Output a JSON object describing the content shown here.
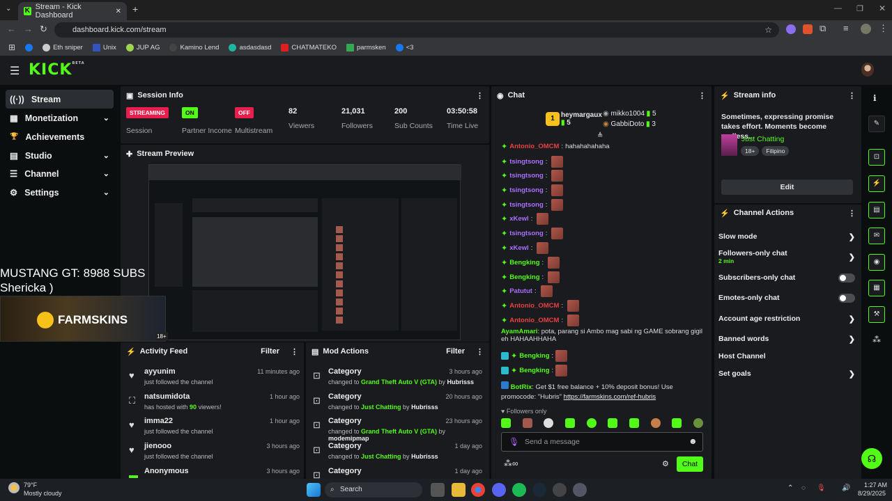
{
  "browser": {
    "tab_title": "Stream - Kick Dashboard",
    "url": "dashboard.kick.com/stream",
    "bookmarks": [
      "Eth sniper",
      "Unix",
      "JUP AG",
      "Kamino Lend",
      "asdasdasd",
      "CHATMATEKO",
      "parmsken",
      "<3"
    ]
  },
  "brand": {
    "logo": "KICK",
    "beta": "BETA"
  },
  "sidebar": {
    "items": [
      {
        "label": "Stream",
        "icon": "((·))"
      },
      {
        "label": "Monetization",
        "icon": "▦"
      },
      {
        "label": "Achievements",
        "icon": "🏆"
      },
      {
        "label": "Studio",
        "icon": "▤"
      },
      {
        "label": "Channel",
        "icon": "☰"
      },
      {
        "label": "Settings",
        "icon": "⚙"
      }
    ]
  },
  "session": {
    "title": "Session Info",
    "stats": [
      {
        "value": "STREAMING",
        "label": "Session"
      },
      {
        "value": "ON",
        "label": "Partner Income"
      },
      {
        "value": "OFF",
        "label": "Multistream"
      },
      {
        "value": "82",
        "label": "Viewers"
      },
      {
        "value": "21,031",
        "label": "Followers"
      },
      {
        "value": "200",
        "label": "Sub Counts"
      },
      {
        "value": "03:50:58",
        "label": "Time Live"
      }
    ]
  },
  "preview": {
    "title": "Stream Preview",
    "overlay_line1": "MUSTANG GT: 8988 SUBS",
    "overlay_line2": "Shericka )",
    "sponsor": "FARMSKINS",
    "rating": "18+"
  },
  "activity": {
    "title": "Activity Feed",
    "filter": "Filter",
    "rows": [
      {
        "name": "ayyunim",
        "text": "just followed the channel",
        "time": "11 minutes ago"
      },
      {
        "name": "natsumidota",
        "text_pre": "has hosted with ",
        "text_hl": "90",
        "text_post": " viewers!",
        "time": "1 hour ago"
      },
      {
        "name": "imma22",
        "text": "just followed the channel",
        "time": "1 hour ago"
      },
      {
        "name": "jienooo",
        "text": "just followed the channel",
        "time": "3 hours ago"
      },
      {
        "name": "Anonymous",
        "text": "",
        "time": "3 hours ago"
      }
    ]
  },
  "mod": {
    "title": "Mod Actions",
    "filter": "Filter",
    "rows": [
      {
        "name": "Category",
        "pre": "changed to ",
        "hl": "Grand Theft Auto V (GTA)",
        "by": "Hubrisss",
        "time": "3 hours ago"
      },
      {
        "name": "Category",
        "pre": "changed to ",
        "hl": "Just Chatting",
        "by": "Hubrisss",
        "time": "20 hours ago"
      },
      {
        "name": "Category",
        "pre": "changed to ",
        "hl": "Grand Theft Auto V (GTA)",
        "by": "modemipmap",
        "time": "23 hours ago"
      },
      {
        "name": "Category",
        "pre": "changed to ",
        "hl": "Just Chatting",
        "by": "Hubrisss",
        "time": "1 day ago"
      },
      {
        "name": "Category",
        "pre": "",
        "hl": "",
        "by": "",
        "time": "1 day ago"
      }
    ]
  },
  "chat": {
    "title": "Chat",
    "top": [
      {
        "rank": "1",
        "name": "heymargaux",
        "count": "5"
      },
      {
        "name": "mikko1004",
        "count": "5"
      },
      {
        "name": "GabbiDoto",
        "count": "3"
      }
    ],
    "lines": [
      {
        "user": "Antonio_OMCM",
        "color": "#e94040",
        "msg": "hahahahahaha",
        "emotes": 0
      },
      {
        "user": "tsingtsong",
        "color": "#a970ff",
        "msg": "",
        "emotes": 1
      },
      {
        "user": "tsingtsong",
        "color": "#a970ff",
        "msg": "",
        "emotes": 1
      },
      {
        "user": "tsingtsong",
        "color": "#a970ff",
        "msg": "",
        "emotes": 1
      },
      {
        "user": "tsingtsong",
        "color": "#a970ff",
        "msg": "",
        "emotes": 1
      },
      {
        "user": "xKewl",
        "color": "#a970ff",
        "msg": "",
        "emotes": 1
      },
      {
        "user": "tsingtsong",
        "color": "#a970ff",
        "msg": "",
        "emotes": 1
      },
      {
        "user": "xKewl",
        "color": "#a970ff",
        "msg": "",
        "emotes": 1
      },
      {
        "user": "Bengking",
        "color": "#53fc18",
        "msg": "",
        "emotes": 1
      },
      {
        "user": "Bengking",
        "color": "#53fc18",
        "msg": "",
        "emotes": 1
      },
      {
        "user": "Patutut",
        "color": "#a970ff",
        "msg": "",
        "emotes": 1
      },
      {
        "user": "Antonio_OMCM",
        "color": "#e94040",
        "msg": "",
        "emotes": 1
      },
      {
        "user": "Antonio_OMCM",
        "color": "#e94040",
        "msg": "",
        "emotes": 1
      }
    ],
    "long1_user": "AyamAmari",
    "long1_msg": "pota, parang si Ambo mag sabi ng GAME sobrang gigil eh HAHAAHHAHA",
    "bk1": "Bengking",
    "bk2": "Bengking",
    "bot_user": "BotRix",
    "bot_msg": "Get $1 free balance + 10% deposit bonus! Use promocode: \"Hubris\" ",
    "bot_link": "https://farmskins.com/ref-hubris",
    "followers_only": "Followers only",
    "placeholder": "Send a message",
    "send": "Chat"
  },
  "streaminfo": {
    "title": "Stream info",
    "text": "Sometimes, expressing promise takes effort. Moments become endless...",
    "category": "Just Chatting",
    "tags": [
      "18+",
      "Filipino"
    ],
    "edit": "Edit"
  },
  "actions": {
    "title": "Channel Actions",
    "rows": [
      {
        "label": "Slow mode",
        "kind": "arrow"
      },
      {
        "label": "Followers-only chat",
        "sub": "2 min",
        "kind": "arrow"
      },
      {
        "label": "Subscribers-only chat",
        "kind": "toggle"
      },
      {
        "label": "Emotes-only chat",
        "kind": "toggle"
      },
      {
        "label": "Account age restriction",
        "kind": "arrow"
      },
      {
        "label": "Banned words",
        "kind": "arrow"
      },
      {
        "label": "Host Channel",
        "kind": "none"
      },
      {
        "label": "Set goals",
        "kind": "arrow"
      }
    ]
  },
  "taskbar": {
    "temp": "79°F",
    "weather": "Mostly cloudy",
    "search": "Search",
    "time": "1:27 AM",
    "date": "8/29/2025"
  },
  "colors": {
    "accent": "#53fc18",
    "panel": "#191b1f",
    "bg": "#0b0e0f",
    "streaming": "#e91e4d"
  }
}
